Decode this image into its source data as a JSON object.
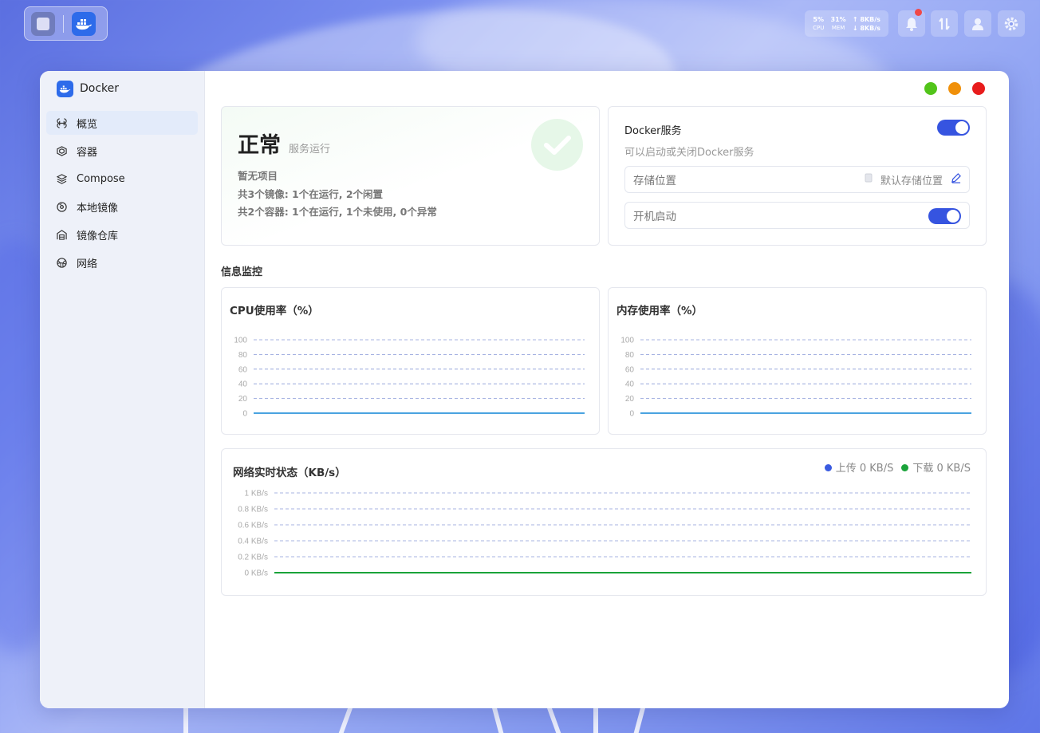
{
  "dock": {
    "apps": [
      {
        "name": "files-app",
        "icon": "file-manager-icon"
      },
      {
        "name": "docker-app",
        "icon": "docker-whale-icon"
      }
    ]
  },
  "system_status": {
    "cpu_value": "5%",
    "cpu_label": "CPU",
    "mem_value": "31%",
    "mem_label": "MEM",
    "upload": "↑ 8KB/s",
    "download": "↓ 8KB/s"
  },
  "app": {
    "title": "Docker"
  },
  "sidebar": {
    "items": [
      {
        "label": "概览",
        "icon": "overview-icon",
        "active": true
      },
      {
        "label": "容器",
        "icon": "container-icon",
        "active": false
      },
      {
        "label": "Compose",
        "icon": "layers-icon",
        "active": false
      },
      {
        "label": "本地镜像",
        "icon": "disc-icon",
        "active": false
      },
      {
        "label": "镜像仓库",
        "icon": "warehouse-icon",
        "active": false
      },
      {
        "label": "网络",
        "icon": "network-icon",
        "active": false
      }
    ]
  },
  "status_card": {
    "state": "正常",
    "state_sub": "服务运行",
    "line1": "暂无项目",
    "line2": "共3个镜像: 1个在运行, 2个闲置",
    "line3": "共2个容器: 1个在运行, 1个未使用, 0个异常"
  },
  "service_card": {
    "title": "Docker服务",
    "desc": "可以启动或关闭Docker服务",
    "service_enabled": true,
    "storage_label": "存储位置",
    "storage_value": "默认存储位置",
    "autostart_label": "开机启动",
    "autostart_enabled": true
  },
  "monitor": {
    "section_title": "信息监控"
  },
  "chart_data": [
    {
      "type": "line",
      "title": "CPU使用率（%）",
      "y_ticks": [
        "100",
        "80",
        "60",
        "40",
        "20",
        "0"
      ],
      "ylim": [
        0,
        100
      ],
      "grid": true,
      "series": [
        {
          "values": [
            0,
            0
          ],
          "color": "#4aa3e0"
        }
      ]
    },
    {
      "type": "line",
      "title": "内存使用率（%）",
      "y_ticks": [
        "100",
        "80",
        "60",
        "40",
        "20",
        "0"
      ],
      "ylim": [
        0,
        100
      ],
      "grid": true,
      "series": [
        {
          "values": [
            0,
            0
          ],
          "color": "#4aa3e0"
        }
      ]
    },
    {
      "type": "line",
      "title": "网络实时状态（KB/s）",
      "y_ticks": [
        "1 KB/s",
        "0.8 KB/s",
        "0.6 KB/s",
        "0.4 KB/s",
        "0.2 KB/s",
        "0 KB/s"
      ],
      "ylim": [
        0,
        1
      ],
      "grid": true,
      "legend_position": "top-right",
      "series": [
        {
          "name": "上传",
          "legend_text": "上传 0 KB/S",
          "values": [
            0,
            0
          ],
          "color": "#3a5be0"
        },
        {
          "name": "下载",
          "legend_text": "下载 0 KB/S",
          "values": [
            0,
            0
          ],
          "color": "#1aa33a"
        }
      ]
    }
  ],
  "colors": {
    "accent": "#3654e0",
    "win_green": "#52c41a",
    "win_orange": "#f0900a",
    "win_red": "#e81c1c"
  }
}
